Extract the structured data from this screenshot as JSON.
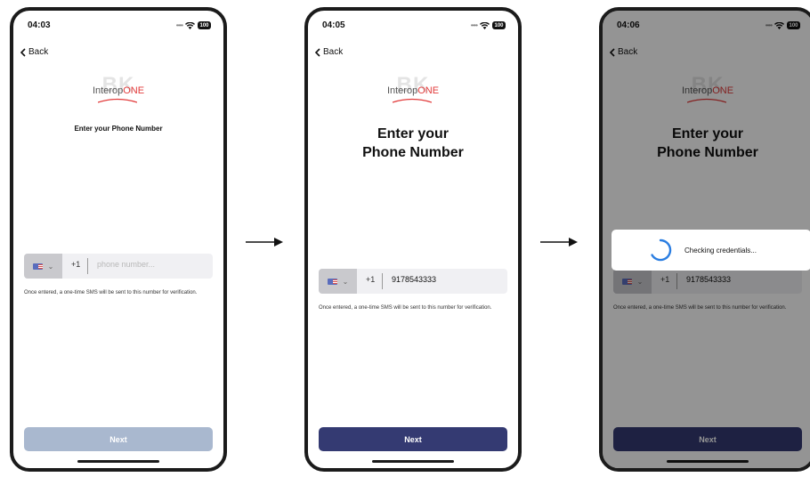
{
  "screens": [
    {
      "status_time": "04:03",
      "battery": "100",
      "back_label": "Back",
      "logo_bg_text": "BK",
      "logo_text_a": "Interop",
      "logo_text_b": "ONE",
      "title": "Enter your Phone Number",
      "flag_icon": "us-flag-icon",
      "country_code": "+1",
      "phone_placeholder": "phone number...",
      "hint": "Once entered, a one-time SMS will be sent to this number for verification.",
      "next_label": "Next",
      "next_state": "disabled"
    },
    {
      "status_time": "04:05",
      "battery": "100",
      "back_label": "Back",
      "logo_bg_text": "BK",
      "logo_text_a": "Interop",
      "logo_text_b": "ONE",
      "title_line1": "Enter your",
      "title_line2": "Phone Number",
      "flag_icon": "us-flag-icon",
      "country_code": "+1",
      "phone_value": "9178543333",
      "hint": "Once entered, a one-time SMS will be sent to this number for verification.",
      "next_label": "Next",
      "next_state": "enabled"
    },
    {
      "status_time": "04:06",
      "battery": "100",
      "back_label": "Back",
      "logo_bg_text": "BK",
      "logo_text_a": "Interop",
      "logo_text_b": "ONE",
      "title_line1": "Enter your",
      "title_line2": "Phone Number",
      "flag_icon": "us-flag-icon",
      "country_code": "+1",
      "phone_value": "9178543333",
      "hint": "Once entered, a one-time SMS will be sent to this number for verification.",
      "next_label": "Next",
      "next_state": "enabled",
      "loading_text": "Checking credentials..."
    }
  ],
  "colors": {
    "next_disabled": "#a9b8cf",
    "next_enabled": "#343a72",
    "spinner": "#2a7de1",
    "logo_accent": "#e23a3a"
  }
}
